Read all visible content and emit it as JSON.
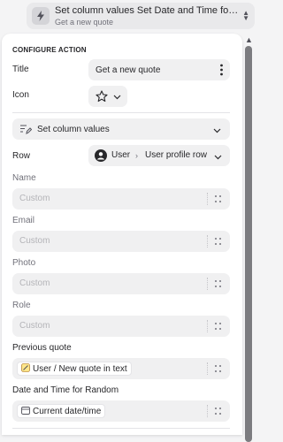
{
  "top_action": {
    "title": "Set column values Set Date and Time for R...",
    "subtitle": "Get a new quote"
  },
  "configure": {
    "heading": "CONFIGURE ACTION",
    "title_label": "Title",
    "title_value": "Get a new quote",
    "icon_label": "Icon"
  },
  "action_select": {
    "label": "Set column values"
  },
  "row": {
    "label": "Row",
    "source": "User",
    "target": "User profile row"
  },
  "fields": [
    {
      "label": "Name",
      "placeholder": "Custom"
    },
    {
      "label": "Email",
      "placeholder": "Custom"
    },
    {
      "label": "Photo",
      "placeholder": "Custom"
    },
    {
      "label": "Role",
      "placeholder": "Custom"
    }
  ],
  "previous_quote": {
    "label": "Previous quote",
    "chip": "User / New quote in text"
  },
  "date_time": {
    "label": "Date and Time for Random",
    "chip": "Current date/time"
  }
}
